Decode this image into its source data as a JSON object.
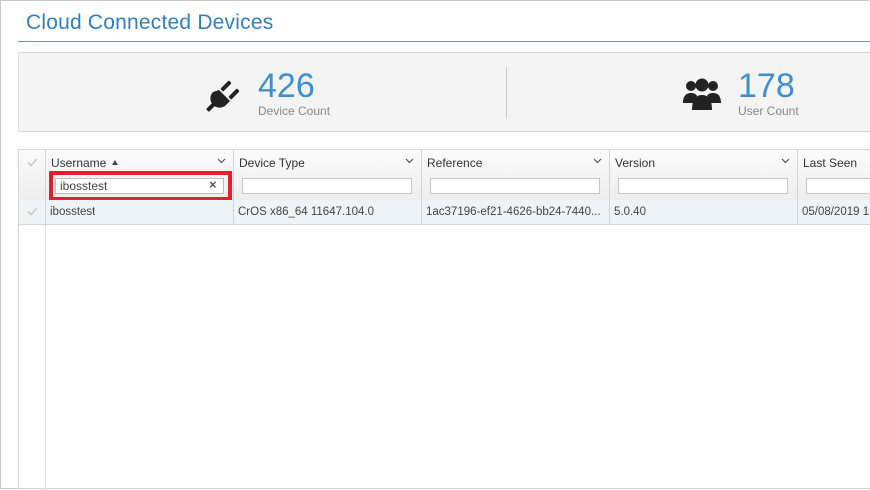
{
  "page": {
    "title": "Cloud Connected Devices"
  },
  "stats": {
    "device": {
      "value": "426",
      "label": "Device Count",
      "icon": "plug-icon"
    },
    "user": {
      "value": "178",
      "label": "User Count",
      "icon": "users-icon"
    }
  },
  "grid": {
    "columns": [
      {
        "label": "Username",
        "sorted": "ascending"
      },
      {
        "label": "Device Type"
      },
      {
        "label": "Reference"
      },
      {
        "label": "Version"
      },
      {
        "label": "Last Seen"
      }
    ],
    "filters": {
      "username": "ibosstest",
      "device_type": "",
      "reference": "",
      "version": "",
      "last_seen": ""
    },
    "rows": [
      {
        "username": "ibosstest",
        "device_type": "CrOS x86_64 11647.104.0",
        "reference": "1ac37196-ef21-4626-bb24-7440...",
        "version": "5.0.40",
        "last_seen": "05/08/2019 1"
      }
    ]
  },
  "colors": {
    "accent": "#2f7fc1",
    "stat_number": "#3d8fd1",
    "highlight": "#e3202b"
  }
}
